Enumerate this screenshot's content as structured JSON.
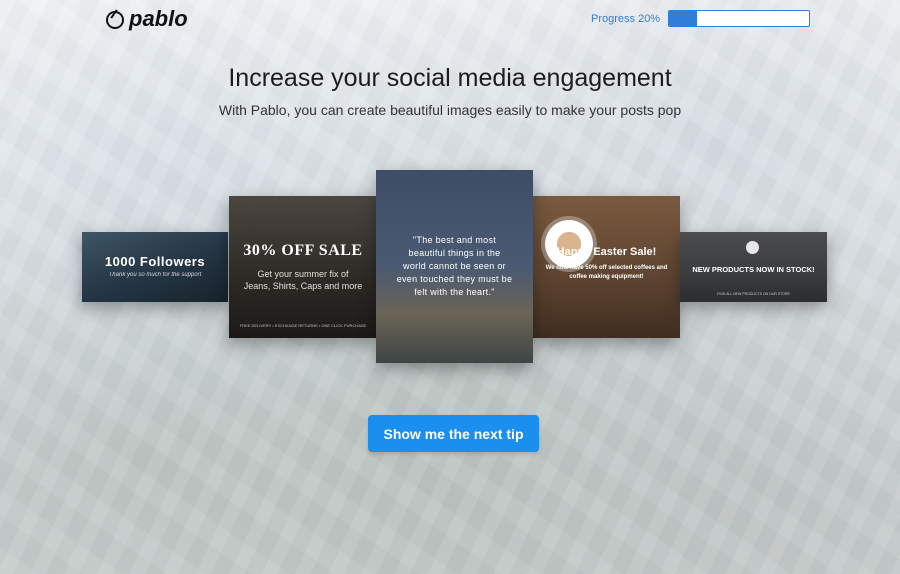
{
  "app": {
    "logo_text": "pablo"
  },
  "progress": {
    "label": "Progress 20%",
    "value": 0.2,
    "color": "#2f7fd8"
  },
  "hero": {
    "title": "Increase your social media engagement",
    "subtitle": "With Pablo, you can create beautiful images easily to make your posts pop"
  },
  "cards": [
    {
      "title": "1000 Followers",
      "subtitle": "Thank you so much for the support"
    },
    {
      "title": "30% OFF SALE",
      "subtitle": "Get your summer fix of Jeans, Shirts, Caps and more",
      "footer": "FREE DELIVERY • EXCHANGE RETURNS • ONE CLICK PURCHASE"
    },
    {
      "quote": "\"The best and most beautiful things in the world cannot be seen or even touched they must be felt with the heart.\""
    },
    {
      "title": "Happy Easter Sale!",
      "subtitle": "We now have 50% off selected coffees and coffee making equipment!"
    },
    {
      "title": "NEW PRODUCTS NOW IN STOCK!",
      "footer": "FIND ALL NEW PRODUCTS ON OUR STORE"
    }
  ],
  "cta": {
    "label": "Show me the next tip",
    "color": "#1a8ff0"
  }
}
